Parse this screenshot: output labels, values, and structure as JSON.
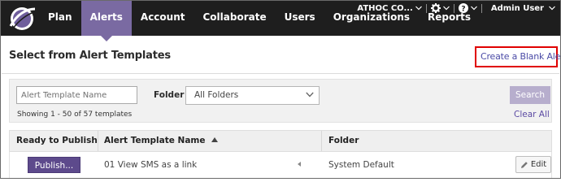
{
  "nav": {
    "items": [
      {
        "label": "Plan",
        "active": false
      },
      {
        "label": "Alerts",
        "active": true
      },
      {
        "label": "Account",
        "active": false
      },
      {
        "label": "Collaborate",
        "active": false
      },
      {
        "label": "Users",
        "active": false
      },
      {
        "label": "Organizations",
        "active": false
      },
      {
        "label": "Reports",
        "active": false
      }
    ],
    "org_label": "ATHOC CO...",
    "user_label": "Admin User",
    "icons": [
      "logo-icon",
      "gear-icon",
      "help-icon",
      "chevron-down-icon"
    ]
  },
  "page": {
    "title": "Select from Alert Templates",
    "create_blank_label": "Create a Blank Alert"
  },
  "filters": {
    "search_placeholder": "Alert Template Name",
    "search_value": "",
    "folder_label": "Folder",
    "folder_selected": "All Folders",
    "search_button": "Search",
    "clear_all": "Clear All",
    "showing": "Showing 1 - 50 of 57 templates"
  },
  "table": {
    "columns": [
      "Ready to Publish",
      "Alert Template Name",
      "Folder"
    ],
    "sorted_column": "Alert Template Name",
    "rows": [
      {
        "publish_label": "Publish...",
        "name": "01 View SMS as a link",
        "folder": "System Default",
        "edit_label": "Edit"
      }
    ]
  },
  "colors": {
    "nav_bg": "#1e1e1e",
    "accent": "#7a6aa2",
    "publish": "#5d4a8c",
    "search_disabled": "#b7aecd",
    "highlight_box": "#e00000"
  }
}
